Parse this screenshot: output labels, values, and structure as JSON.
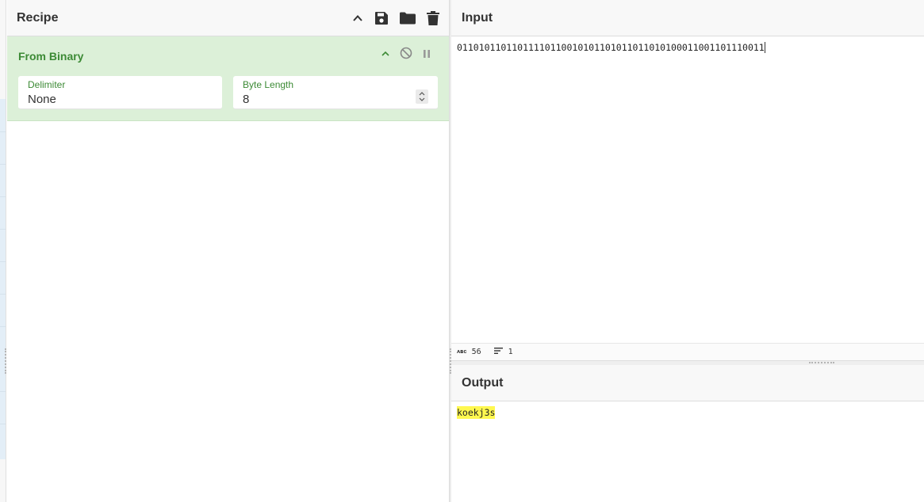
{
  "recipe": {
    "title": "Recipe",
    "icons": [
      "chevron-up-icon",
      "save-icon",
      "folder-icon",
      "trash-icon"
    ],
    "operation": {
      "name": "From Binary",
      "controls": [
        "chevron-up-icon",
        "disable-icon",
        "pause-icon"
      ],
      "delimiter": {
        "label": "Delimiter",
        "value": "None"
      },
      "byte_length": {
        "label": "Byte Length",
        "value": "8"
      }
    }
  },
  "input": {
    "title": "Input",
    "value": "01101011011011110110010101101011011010100011001101110011",
    "status": {
      "length": "56",
      "lines": "1"
    }
  },
  "output": {
    "title": "Output",
    "value": "koekj3s"
  },
  "colors": {
    "operation_bg": "#dcf0d8",
    "operation_text": "#3c8a35",
    "highlight": "#fff84f"
  }
}
